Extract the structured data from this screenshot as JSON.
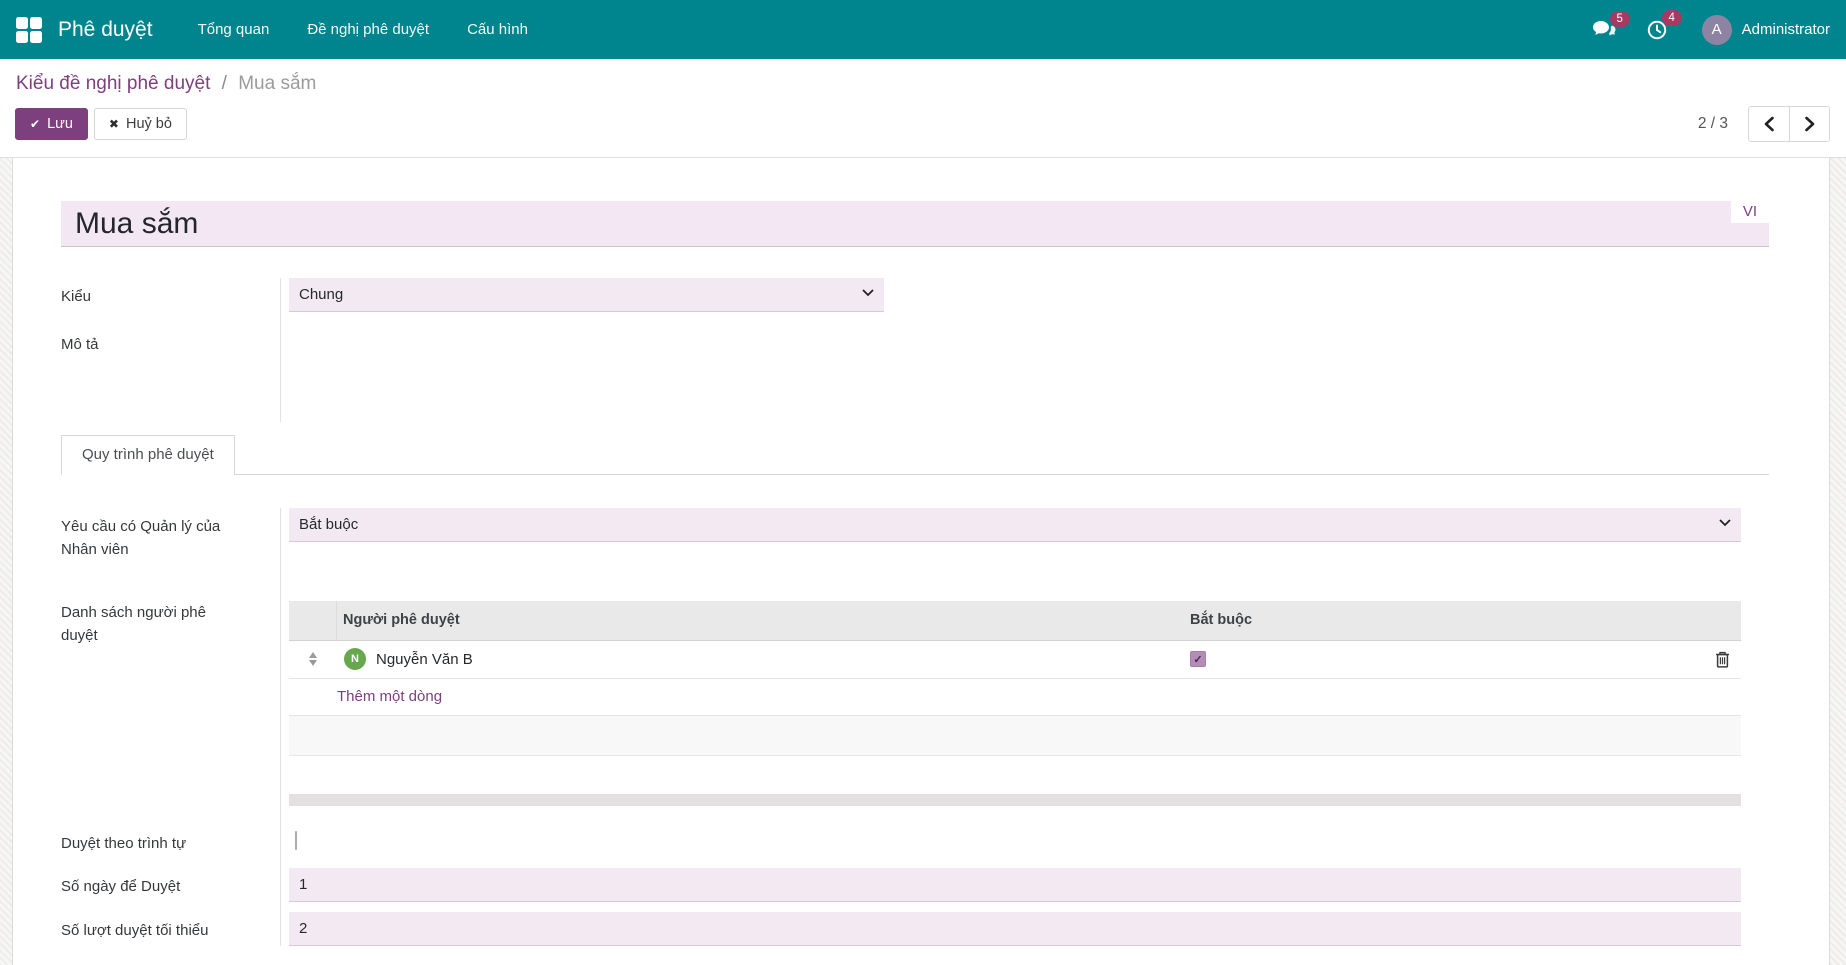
{
  "navbar": {
    "app_name": "Phê duyệt",
    "menu": [
      "Tổng quan",
      "Đề nghị phê duyệt",
      "Cấu hình"
    ],
    "messages_badge": "5",
    "activities_badge": "4",
    "user_initial": "A",
    "user_name": "Administrator"
  },
  "breadcrumb": {
    "parent": "Kiểu đề nghị phê duyệt",
    "separator": "/",
    "current": "Mua sắm"
  },
  "control_panel": {
    "save": "Lưu",
    "discard": "Huỷ bỏ",
    "pager": "2 / 3"
  },
  "form": {
    "title": "Mua sắm",
    "translation_tag": "VI",
    "type_label": "Kiểu",
    "type_value": "Chung",
    "description_label": "Mô tả",
    "tab_label": "Quy trình phê duyệt",
    "manager_label": "Yêu cầu có Quản lý của Nhân viên",
    "manager_value": "Bắt buộc",
    "approvers_label": "Danh sách người phê duyệt",
    "table": {
      "col_approver": "Người phê duyệt",
      "col_required": "Bắt buộc",
      "row": {
        "avatar_initial": "N",
        "name": "Nguyễn Văn B",
        "required": true
      },
      "add_line": "Thêm một dòng"
    },
    "sequential_label": "Duyệt theo trình tự",
    "sequential_checked": false,
    "days_label": "Số ngày để Duyệt",
    "days_value": "1",
    "min_label": "Số lượt duyệt tối thiểu",
    "min_value": "2"
  },
  "colors": {
    "navbar_bg": "#00848e",
    "accent_purple": "#7d3f7d",
    "badge_pink": "#a73a63",
    "input_bg": "#f3e9f3",
    "avatar_green": "#67a84f"
  }
}
